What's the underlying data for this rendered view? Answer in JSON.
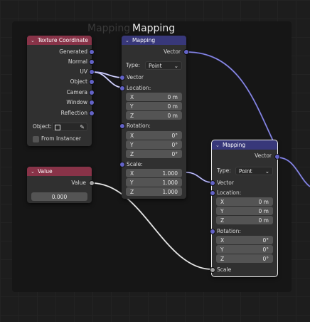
{
  "frame": {
    "title": "Mapping"
  },
  "colors": {
    "vector_socket": "#6363c7",
    "float_socket": "#a1a1a1",
    "header_texture": "#883348",
    "header_vector": "#38387a"
  },
  "texture_coordinate": {
    "title": "Texture Coordinate",
    "outputs": [
      "Generated",
      "Normal",
      "UV",
      "Object",
      "Camera",
      "Window",
      "Reflection"
    ],
    "object_label": "Object:",
    "from_instancer": "From Instancer"
  },
  "mapping1": {
    "title": "Mapping",
    "output": "Vector",
    "type_label": "Type:",
    "type_value": "Point",
    "vector_input": "Vector",
    "location_label": "Location:",
    "location": [
      {
        "axis": "X",
        "value": "0 m"
      },
      {
        "axis": "Y",
        "value": "0 m"
      },
      {
        "axis": "Z",
        "value": "0 m"
      }
    ],
    "rotation_label": "Rotation:",
    "rotation": [
      {
        "axis": "X",
        "value": "0°"
      },
      {
        "axis": "Y",
        "value": "0°"
      },
      {
        "axis": "Z",
        "value": "0°"
      }
    ],
    "scale_label": "Scale:",
    "scale": [
      {
        "axis": "X",
        "value": "1.000"
      },
      {
        "axis": "Y",
        "value": "1.000"
      },
      {
        "axis": "Z",
        "value": "1.000"
      }
    ]
  },
  "value_node": {
    "title": "Value",
    "output": "Value",
    "value": "0.000"
  },
  "mapping2": {
    "title": "Mapping",
    "output": "Vector",
    "type_label": "Type:",
    "type_value": "Point",
    "vector_input": "Vector",
    "location_label": "Location:",
    "location": [
      {
        "axis": "X",
        "value": "0 m"
      },
      {
        "axis": "Y",
        "value": "0 m"
      },
      {
        "axis": "Z",
        "value": "0 m"
      }
    ],
    "rotation_label": "Rotation:",
    "rotation": [
      {
        "axis": "X",
        "value": "0°"
      },
      {
        "axis": "Y",
        "value": "0°"
      },
      {
        "axis": "Z",
        "value": "0°"
      }
    ],
    "scale_label": "Scale"
  }
}
